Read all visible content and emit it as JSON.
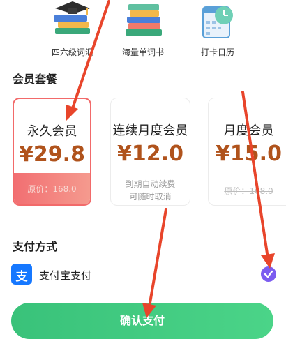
{
  "features": [
    {
      "label": "四六级词汇",
      "icon": "graduation-books-icon"
    },
    {
      "label": "海量单词书",
      "icon": "book-stack-icon"
    },
    {
      "label": "打卡日历",
      "icon": "calendar-clock-icon"
    }
  ],
  "membership": {
    "title": "会员套餐",
    "plans": [
      {
        "name": "永久会员",
        "price": "¥29.8",
        "original": "原价：168.0",
        "selected": true
      },
      {
        "name": "连续月度会员",
        "price": "¥12.0",
        "note_line1": "到期自动续费",
        "note_line2": "可随时取消"
      },
      {
        "name": "月度会员",
        "price": "¥15.0",
        "original": "原价：168.0"
      }
    ]
  },
  "payment": {
    "title": "支付方式",
    "method_label": "支付宝支付",
    "method_icon_char": "支",
    "selected": true
  },
  "confirm_button": "确认支付",
  "colors": {
    "accent_red": "#f26a6a",
    "price": "#b0531c",
    "confirm_green": "#3fc87f",
    "check_purple": "#7b5cf0",
    "alipay_blue": "#1678ff",
    "annotation_arrow": "#e8452b"
  }
}
